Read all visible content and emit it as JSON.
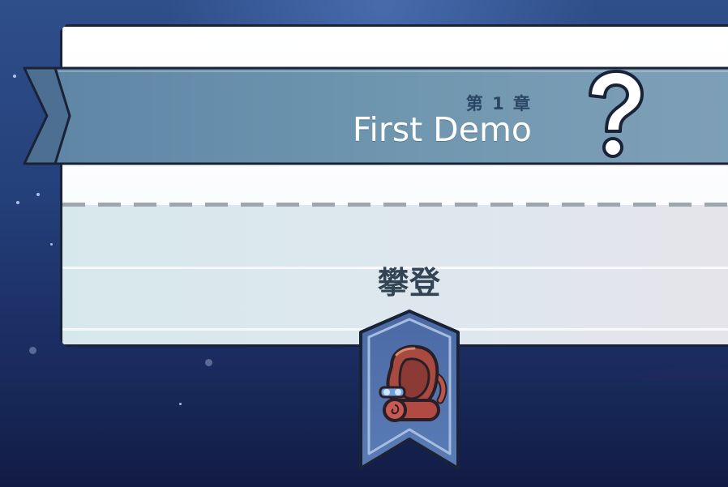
{
  "chapter": {
    "label": "第 1 章",
    "title": "First Demo",
    "status_icon": "question-mark-icon"
  },
  "stage": {
    "name": "攀登",
    "badge_icon": "backpack-icon"
  },
  "colors": {
    "ribbon": "#6f94ad",
    "ribbon_dark": "#4d6f92",
    "badge": "#4f6fa8",
    "outline": "#1a2238"
  }
}
